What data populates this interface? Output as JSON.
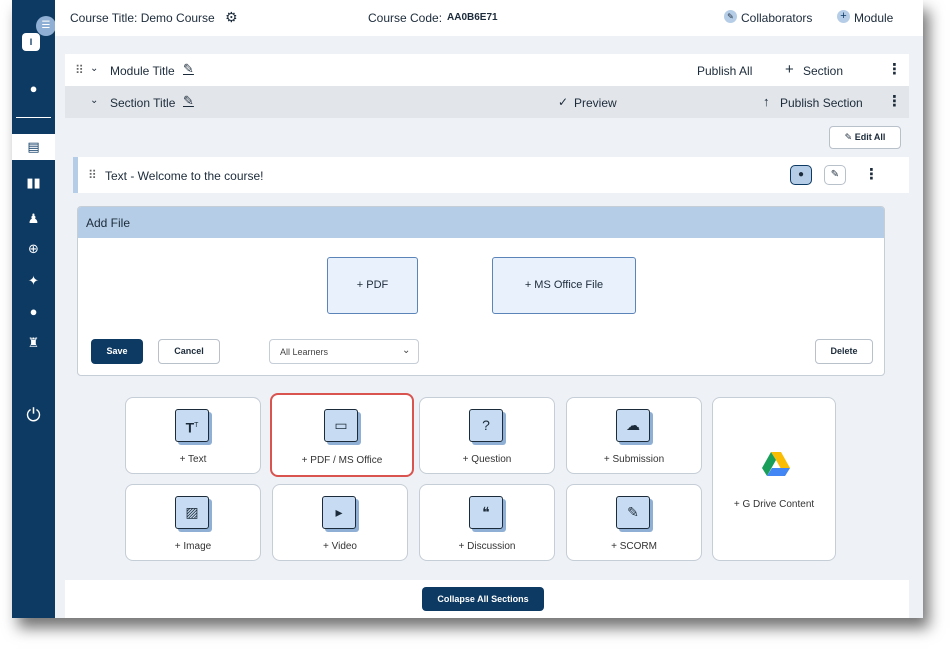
{
  "topbar": {
    "course_title": "Course Title: Demo Course",
    "course_code_label": "Course Code:",
    "course_code": "AA0B6E71",
    "collaborators": "Collaborators",
    "module": "Module"
  },
  "module_row": {
    "title": "Module Title",
    "publish_all": "Publish All",
    "section": "Section"
  },
  "section_row": {
    "title": "Section Title",
    "preview": "Preview",
    "publish_section": "Publish Section"
  },
  "edit_all": "Edit All",
  "text_item": "Text - Welcome to the course!",
  "add_file": {
    "heading": "Add File",
    "pdf": "+ PDF",
    "ms_office": "+ MS Office File",
    "save": "Save",
    "cancel": "Cancel",
    "audience": "All Learners",
    "delete": "Delete"
  },
  "content_tiles": [
    {
      "label": "+ Text",
      "icon": "text-icon"
    },
    {
      "label": "+ PDF / MS Office",
      "icon": "folder-icon"
    },
    {
      "label": "+ Question",
      "icon": "question-icon"
    },
    {
      "label": "+ Submission",
      "icon": "upload-icon"
    },
    {
      "label": "+ Image",
      "icon": "image-icon"
    },
    {
      "label": "+ Video",
      "icon": "video-icon"
    },
    {
      "label": "+ Discussion",
      "icon": "discussion-icon"
    },
    {
      "label": "+ SCORM",
      "icon": "scorm-icon"
    }
  ],
  "gdrive": "+ G Drive Content",
  "collapse_all": "Collapse All Sections",
  "sidebar": {
    "avatar_initial": "I",
    "icons": [
      "user-icon",
      "gradebook-icon",
      "book-icon",
      "people-icon",
      "plus-circle-icon",
      "sparkle-icon",
      "chat-icon",
      "robot-icon",
      "power-icon"
    ]
  },
  "colors": {
    "navy": "#0d3a63",
    "accent_light": "#b5cde6",
    "highlight": "#d9534f"
  }
}
